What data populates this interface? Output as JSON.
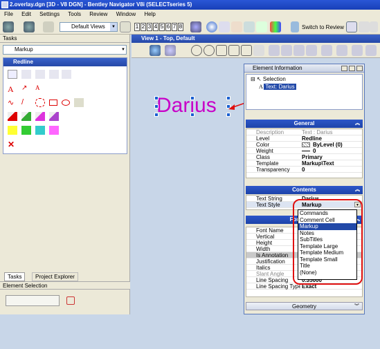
{
  "window": {
    "title": "2.overlay.dgn [3D - V8 DGN] - Bentley Navigator V8i (SELECTseries 5)"
  },
  "menu": [
    "File",
    "Edit",
    "Settings",
    "Tools",
    "Review",
    "Window",
    "Help"
  ],
  "toolbar": {
    "views_combo": "Default Views",
    "view_numbers": [
      "1",
      "2",
      "3",
      "4",
      "5",
      "6",
      "7",
      "8"
    ],
    "switch_review": "Switch to Review"
  },
  "tasks": {
    "title": "Tasks",
    "combo": "Markup",
    "redline_title": "Redline",
    "tab_tasks": "Tasks",
    "tab_explorer": "Project Explorer",
    "element_selection": "Element Selection"
  },
  "view": {
    "title": "View 1 - Top, Default",
    "text_element": "Darius"
  },
  "element_info": {
    "title": "Element Information",
    "tree_root": "Selection",
    "tree_child": "Text: Darius",
    "general": {
      "header": "General",
      "rows": [
        {
          "k": "Description",
          "v": "Text : Darius"
        },
        {
          "k": "Level",
          "v": "Redline"
        },
        {
          "k": "Color",
          "v": "ByLevel (0)"
        },
        {
          "k": "Weight",
          "v": "0"
        },
        {
          "k": "Class",
          "v": "Primary"
        },
        {
          "k": "Template",
          "v": "Markup\\Text"
        },
        {
          "k": "Transparency",
          "v": "0"
        }
      ]
    },
    "contents": {
      "header": "Contents",
      "rows": [
        {
          "k": "Text String",
          "v": "Darius"
        },
        {
          "k": "Text Style",
          "v": "Markup"
        }
      ]
    },
    "formatting": {
      "header": "Formatting",
      "rows": [
        {
          "k": "Font Name",
          "v": ""
        },
        {
          "k": "Vertical",
          "v": ""
        },
        {
          "k": "Height",
          "v": ""
        },
        {
          "k": "Width",
          "v": ""
        },
        {
          "k": "Is Annotation",
          "v": ""
        },
        {
          "k": "Justification",
          "v": ""
        },
        {
          "k": "Italics",
          "v": ""
        },
        {
          "k": "Slant Angle",
          "v": ""
        },
        {
          "k": "Line Spacing",
          "v": "0.35000"
        },
        {
          "k": "Line Spacing Type",
          "v": "Exact"
        }
      ]
    },
    "geometry": {
      "header": "Geometry"
    },
    "dropdown": [
      "Commands",
      "Comment Cell",
      "Markup",
      "Notes",
      "SubTitles",
      "Template Large",
      "Template Medium",
      "Template Small",
      "Title",
      "(None)"
    ],
    "dropdown_selected": "Markup"
  },
  "colors": {
    "accent": "#c800c8",
    "annotation": "#e01010",
    "selection": "#2249a8"
  }
}
